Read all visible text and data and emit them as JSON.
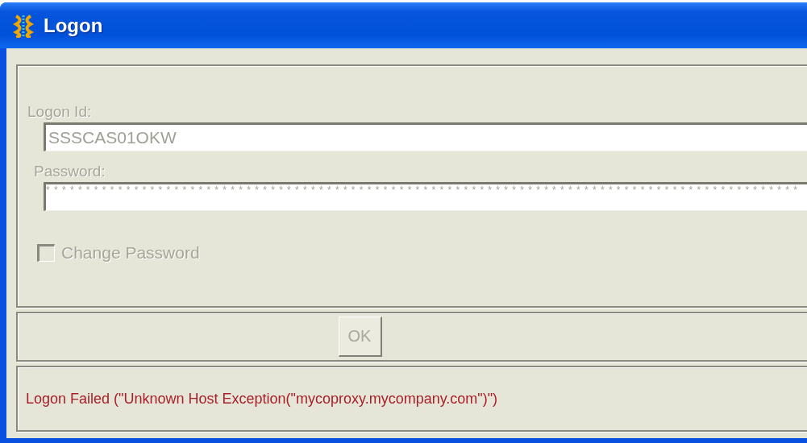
{
  "window": {
    "title": "Logon"
  },
  "form": {
    "fields": [
      {
        "label": "Logon Id:",
        "value": "SSSCAS01OKW",
        "kind": "text",
        "disabled": true
      },
      {
        "label": "Password:",
        "value": "**********************************************************************************************",
        "kind": "password",
        "disabled": true
      }
    ],
    "checkbox": {
      "label": "Change Password",
      "checked": false,
      "disabled": true
    }
  },
  "buttons": [
    {
      "label": "OK",
      "disabled": true
    }
  ],
  "status": {
    "message": "Logon Failed (\"Unknown Host Exception(\"mycoproxy.mycompany.com\")\")"
  }
}
